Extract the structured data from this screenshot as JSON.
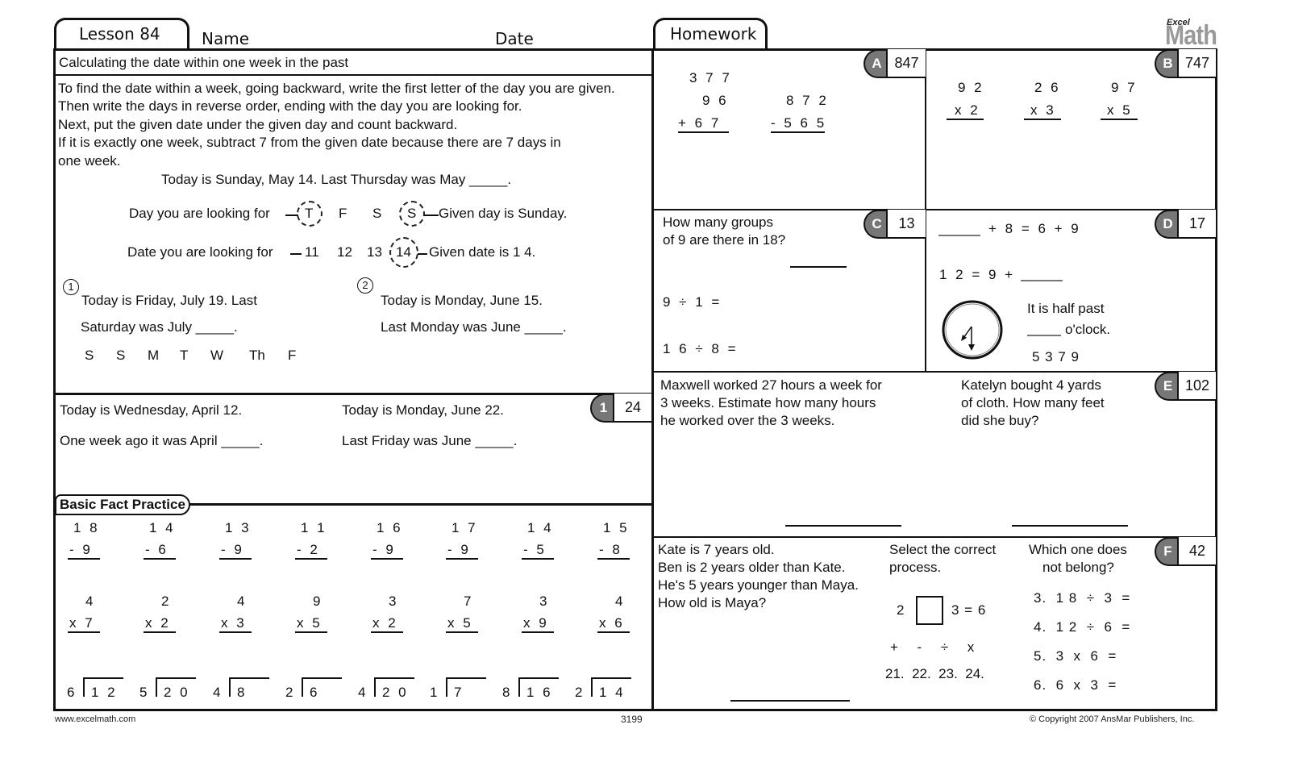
{
  "header": {
    "lesson_tab": "Lesson 84",
    "name_label": "Name",
    "date_label": "Date",
    "homework_tab": "Homework",
    "logo_top": "Excel",
    "logo_bottom": "Math"
  },
  "lesson": {
    "title": "Calculating the date within one week in the past",
    "instructions": [
      "To find the date within a week, going backward, write the first letter of the day you are given.",
      "Then write the days in reverse order, ending with the day you are looking for.",
      "Next, put the given date under the given day and count backward.",
      "If it is exactly one week, subtract 7 from the given date because there are 7 days in",
      "one week."
    ],
    "example": {
      "prompt": "Today is Sunday, May 14.  Last Thursday was May _____.",
      "day_label": "Day you are looking for",
      "days": [
        "T",
        "F",
        "S",
        "S"
      ],
      "day_note": "Given day is Sunday.",
      "date_label": "Date you are looking for",
      "dates": [
        "11",
        "12",
        "13",
        "14"
      ],
      "date_note": "Given date is 1 4."
    },
    "problems": [
      {
        "number": "1",
        "line1": "Today is Friday, July 19.  Last",
        "line2": "Saturday was July _____.",
        "days": [
          "S",
          "S",
          "M",
          "T",
          "W",
          "Th",
          "F"
        ]
      },
      {
        "number": "2",
        "line1": "Today is Monday, June 15.",
        "line2": "Last Monday was June _____."
      }
    ],
    "section1": {
      "badge": "1",
      "score": "24",
      "left_line1": "Today is Wednesday, April 12.",
      "left_line2": "One week ago it was April _____.",
      "right_line1": "Today is Monday, June 22.",
      "right_line2": "Last Friday was June _____."
    }
  },
  "basic_facts": {
    "title": "Basic Fact Practice",
    "subtraction": [
      {
        "top": "1 8",
        "bottom": "- 9"
      },
      {
        "top": "1 4",
        "bottom": "- 6"
      },
      {
        "top": "1 3",
        "bottom": "- 9"
      },
      {
        "top": "1 1",
        "bottom": "- 2"
      },
      {
        "top": "1 6",
        "bottom": "- 9"
      },
      {
        "top": "1 7",
        "bottom": "- 9"
      },
      {
        "top": "1 4",
        "bottom": "- 5"
      },
      {
        "top": "1 5",
        "bottom": "- 8"
      }
    ],
    "multiplication": [
      {
        "top": "4",
        "bottom": "x 7"
      },
      {
        "top": "2",
        "bottom": "x 2"
      },
      {
        "top": "4",
        "bottom": "x 3"
      },
      {
        "top": "9",
        "bottom": "x 5"
      },
      {
        "top": "3",
        "bottom": "x 2"
      },
      {
        "top": "7",
        "bottom": "x 5"
      },
      {
        "top": "3",
        "bottom": "x 9"
      },
      {
        "top": "4",
        "bottom": "x 6"
      }
    ],
    "division": [
      {
        "divisor": "6",
        "dividend": "1 2"
      },
      {
        "divisor": "5",
        "dividend": "2 0"
      },
      {
        "divisor": "4",
        "dividend": "8"
      },
      {
        "divisor": "2",
        "dividend": "6"
      },
      {
        "divisor": "4",
        "dividend": "2 0"
      },
      {
        "divisor": "1",
        "dividend": "7"
      },
      {
        "divisor": "8",
        "dividend": "1 6"
      },
      {
        "divisor": "2",
        "dividend": "1 4"
      }
    ]
  },
  "homework": {
    "A": {
      "badge": "A",
      "score": "847",
      "add": [
        "3 7 7",
        "9 6",
        "+  6 7"
      ],
      "sub": [
        "8 7 2",
        "- 5 6 5"
      ]
    },
    "B": {
      "badge": "B",
      "score": "747",
      "problems": [
        {
          "top": "9 2",
          "bottom": "x 2"
        },
        {
          "top": "2 6",
          "bottom": "x 3"
        },
        {
          "top": "9 7",
          "bottom": "x 5"
        }
      ]
    },
    "C": {
      "badge": "C",
      "score": "13",
      "question_line1": "How many groups",
      "question_line2": "of 9 are there in 18?",
      "eq1": "9  ÷  1  =",
      "eq2": "1 6  ÷  8  ="
    },
    "D": {
      "badge": "D",
      "score": "17",
      "eq1": "+  8  =  6  +  9",
      "eq2": "1 2  =  9  +",
      "clock_line1": "It is half past",
      "clock_line2": "o'clock.",
      "choices": "5   3   7   9"
    },
    "E": {
      "badge": "E",
      "score": "102",
      "left_lines": [
        "Maxwell worked 27 hours a week for",
        "3 weeks. Estimate how many hours",
        "he worked over the 3 weeks."
      ],
      "right_lines": [
        "Katelyn bought 4 yards",
        "of cloth. How many feet",
        "did she buy?"
      ]
    },
    "F": {
      "badge": "F",
      "score": "42",
      "left_lines": [
        "Kate is 7 years old.",
        "Ben is 2 years older than Kate.",
        "He's 5 years younger than Maya.",
        "How old is Maya?"
      ],
      "mid_title": [
        "Select the correct",
        "process."
      ],
      "mid_eq_left": "2",
      "mid_eq_right": "3  =  6",
      "mid_ops": "+     -     ÷     x",
      "mid_choices": "21.  22.  23.  24.",
      "right_title": [
        "Which one does",
        "not belong?"
      ],
      "right_items": [
        "3.  1 8  ÷  3  =",
        "4.  1 2  ÷  6  =",
        "5.  3  x  6  =",
        "6.  6  x  3  ="
      ]
    }
  },
  "footer": {
    "website": "www.excelmath.com",
    "page_number": "3199",
    "copyright": "© Copyright 2007 AnsMar Publishers, Inc."
  }
}
